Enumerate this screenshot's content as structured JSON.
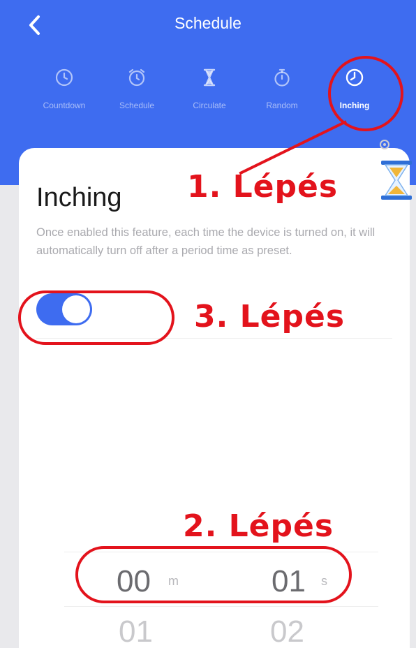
{
  "header": {
    "title": "Schedule",
    "background": "#3e6cf0"
  },
  "tabs": [
    {
      "label": "Countdown",
      "icon": "clock-icon",
      "active": false
    },
    {
      "label": "Schedule",
      "icon": "alarm-clock-icon",
      "active": false
    },
    {
      "label": "Circulate",
      "icon": "hourglass-icon",
      "active": false
    },
    {
      "label": "Random",
      "icon": "stopwatch-icon",
      "active": false
    },
    {
      "label": "Inching",
      "icon": "clock-icon",
      "active": true
    }
  ],
  "card": {
    "title": "Inching",
    "description": "Once enabled this feature,   each time the device is turned on, it will automatically turn off after a period time as preset.",
    "toggle_on": true
  },
  "picker": {
    "minutes_selected": "00",
    "minutes_unit": "m",
    "minutes_next": "01",
    "seconds_selected": "01",
    "seconds_unit": "s",
    "seconds_next": "02"
  },
  "annotations": {
    "step1": "1. Lépés",
    "step2": "2. Lépés",
    "step3": "3. Lépés",
    "color": "#e3131c"
  }
}
